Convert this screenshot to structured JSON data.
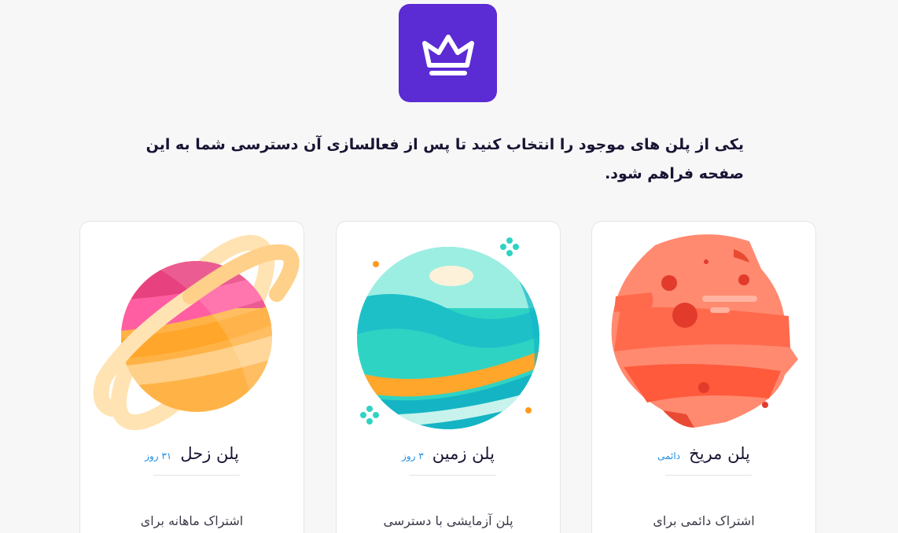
{
  "hero": {
    "icon": "crown-icon"
  },
  "intro_text": "یکی از پلن های موجود را انتخاب کنید تا پس از فعالسازی آن دسترسی شما به این صفحه فراهم شود.",
  "plans": [
    {
      "title": "پلن مریخ",
      "badge": "دائمی",
      "description": "اشتراک دائمی برای",
      "illustration": "mars-planet-icon"
    },
    {
      "title": "پلن زمین",
      "badge": "۳ روز",
      "description": "پلن آزمایشی با دسترسی",
      "illustration": "earth-planet-icon"
    },
    {
      "title": "پلن زحل",
      "badge": "۳۱ روز",
      "description": "اشتراک ماهانه برای",
      "illustration": "saturn-planet-icon"
    }
  ],
  "colors": {
    "accent": "#5b2bd3",
    "badge": "#1f8fe6",
    "background": "#f7f7f8"
  }
}
